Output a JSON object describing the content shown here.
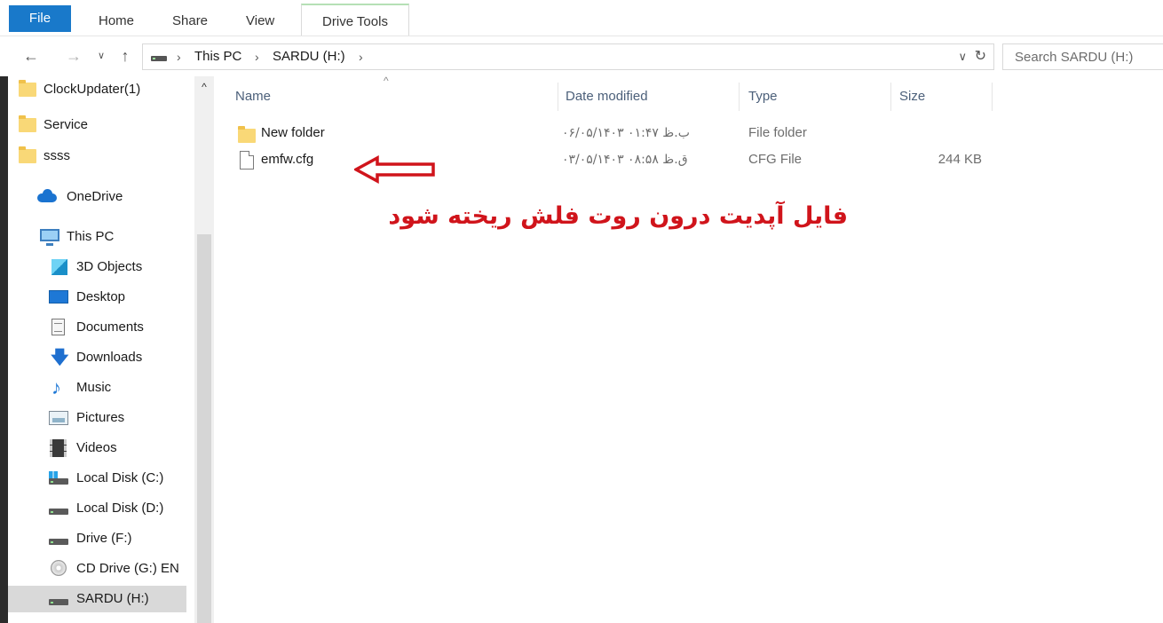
{
  "ribbon": {
    "tabs": [
      "File",
      "Home",
      "Share",
      "View",
      "Drive Tools"
    ]
  },
  "address": {
    "back_icon": "back-arrow-icon",
    "forward_icon": "forward-arrow-icon",
    "recent_icon": "chevron-down-icon",
    "up_icon": "up-arrow-icon",
    "crumbs": [
      "This PC",
      "SARDU (H:)"
    ],
    "refresh_icon": "refresh-icon"
  },
  "search": {
    "placeholder": "Search SARDU (H:)"
  },
  "nav_pane": {
    "items": [
      {
        "label": "ClockUpdater(1)",
        "icon": "folder-icon"
      },
      {
        "label": "Service",
        "icon": "folder-icon"
      },
      {
        "label": "ssss",
        "icon": "folder-icon"
      },
      {
        "label": "OneDrive",
        "icon": "cloud-icon"
      },
      {
        "label": "This PC",
        "icon": "computer-icon"
      },
      {
        "label": "3D Objects",
        "icon": "cube-icon"
      },
      {
        "label": "Desktop",
        "icon": "desktop-icon"
      },
      {
        "label": "Documents",
        "icon": "documents-icon"
      },
      {
        "label": "Downloads",
        "icon": "download-icon"
      },
      {
        "label": "Music",
        "icon": "music-icon"
      },
      {
        "label": "Pictures",
        "icon": "pictures-icon"
      },
      {
        "label": "Videos",
        "icon": "videos-icon"
      },
      {
        "label": "Local Disk (C:)",
        "icon": "system-drive-icon"
      },
      {
        "label": "Local Disk (D:)",
        "icon": "drive-icon"
      },
      {
        "label": "Drive (F:)",
        "icon": "drive-icon"
      },
      {
        "label": "CD Drive (G:) EN",
        "icon": "cd-drive-icon"
      },
      {
        "label": "SARDU (H:)",
        "icon": "drive-icon",
        "selected": true
      }
    ]
  },
  "columns": {
    "name": "Name",
    "date": "Date modified",
    "type": "Type",
    "size": "Size"
  },
  "files": [
    {
      "name": "New folder",
      "date": "۰۶/۰۵/۱۴۰۳ ب.ظ ۰۱:۴۷",
      "type": "File folder",
      "size": "",
      "icon": "folder-icon"
    },
    {
      "name": "emfw.cfg",
      "date": "۰۳/۰۵/۱۴۰۳ ق.ظ ۰۸:۵۸",
      "type": "CFG File",
      "size": "244 KB",
      "icon": "file-icon"
    }
  ],
  "annotation": {
    "text": "فایل آپدیت درون روت فلش ریخته شود",
    "color": "#d0141b",
    "arrow_icon": "left-arrow-icon"
  }
}
